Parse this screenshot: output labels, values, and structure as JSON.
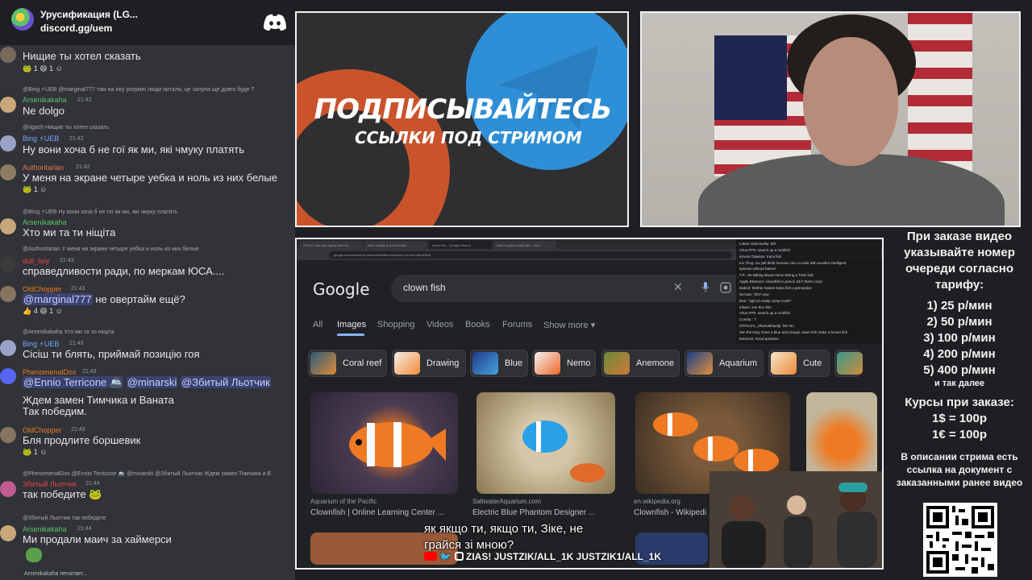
{
  "server": {
    "name": "Урусификация (LG...",
    "invite": "discord.gg/uem"
  },
  "chat": {
    "typing": "Arsenikakaha печатает...",
    "messages": [
      {
        "body": "Нищие ты хотел сказать",
        "reactions": "1 😄 1"
      },
      {
        "reply": "@Bing ⚡UEB @marginal777 там на кіку розумні люди питали, це залупа ще довго буде ?",
        "user": "Arsenikakaha",
        "user_color": "#5dc16c",
        "time": "21:42",
        "body": "Ne dolgo"
      },
      {
        "reply": "@rigach Нищие ты хотел сказать",
        "user": "Bing ⚡UEB",
        "user_color": "#7aa7ff",
        "time": "21:42",
        "body": "Ну вони хоча б не гої як ми, які чмуку платять"
      },
      {
        "user": "Authoritarian",
        "user_color": "#e0774f",
        "time": "21:42",
        "body": "У меня на экране четыре уебка и ноль из них белые",
        "reactions": "1"
      },
      {
        "reply": "@Bing ⚡UEB Ну вони хоча б не гої як ми, які чмуку платять",
        "user": "Arsenikakaha",
        "user_color": "#5dc16c",
        "body": "Хто ми та ти ніщіта"
      },
      {
        "reply": "@Authoritarian У меня на экране четыре уебка и ноль из них белые",
        "user": "dull_boy",
        "user_color": "#ed4245",
        "time": "21:43",
        "body": "справедливости ради, по меркам ЮСА...."
      },
      {
        "user": "OldChopper",
        "user_color": "#e67e22",
        "time": "21:43",
        "body_mention": "@marginal777",
        "body": " не овертайм ещё?",
        "reactions": "4 😄 1"
      },
      {
        "reply": "@Arsenikakaha Хто ми та ти ніщіта",
        "user": "Bing ⚡UEB",
        "user_color": "#7aa7ff",
        "time": "21:43",
        "body": "Сісіш ти блять, приймай позицію гоя"
      },
      {
        "user": "PhenomenalDox",
        "user_color": "#e67e22",
        "time": "21:43",
        "mentions": [
          "@Ennio Terricone 🚢",
          "@minarski",
          "@Збитый Льотчик"
        ],
        "body": "Ждем замен Тимчика и Ваната",
        "body2": "Так победим."
      },
      {
        "user": "OldChopper",
        "user_color": "#e67e22",
        "time": "21:43",
        "body": "Бля продлите боршевик",
        "reactions": "1"
      },
      {
        "reply": "@PhenomenalDox @Ennio Terricone 🚢 @minarski @Збитый Льотчик Ждем замен Тимчика и В",
        "user": "Збитый Льотчик",
        "user_color": "#ed4245",
        "time": "21:44",
        "body": "так победите"
      },
      {
        "reply": "@Збитый Льотчик так победите",
        "user": "Arsenikakaha",
        "user_color": "#5dc16c",
        "time": "21:44",
        "body": "Ми продали маич за хаймерси"
      }
    ]
  },
  "promo": {
    "title": "ПОДПИСЫВАЙТЕСЬ",
    "subtitle": "ССЫЛКИ ПОД СТРИМОМ"
  },
  "browser": {
    "tabs": [
      "STALC: live chat replay (flud.io)",
      "what exactly is a clown fish",
      "clown fish - Google Search",
      "what is green mask fish - Goo..."
    ],
    "url": "google.com/search?q=clown+fish&tbm=isch&sa=X&ved=2ahUKEwj",
    "query": "clown fish",
    "nav": [
      "All",
      "Images",
      "Shopping",
      "Videos",
      "Books",
      "Forums",
      "Show more ▾"
    ],
    "chips": [
      "Coral reef",
      "Drawing",
      "Blue",
      "Nemo",
      "Anemone",
      "Aquarium",
      "Cute"
    ],
    "results": [
      {
        "source": "Aquarium of the Pacific",
        "title": "Clownfish | Online Learning Center ..."
      },
      {
        "source": "SaltwaterAquarium.com",
        "title": "Electric Blue Phantom Designer ..."
      },
      {
        "source": "en.wikipedia.org",
        "title": "Clownfish - Wikipedi"
      }
    ],
    "subtitle": "як якщо ти, якщо ти, Зіке, не грайся зі мною?",
    "socials": "ZIAS!  JUSTZIK/ALL_1K   JUSTZIK1/ALL_1K",
    "overlay_lines": [
      "Lukas Hosinovsky: 0/0",
      "Virus FPS: search up a rockfish",
      "Kevzer Dawson: trans fish",
      "Ice Thug: So yall think humans can co exist with another intelligent",
      "species without hatred",
      "T.P.: He talking about Homo Being a Train hull",
      "Apple Blossom: clownfish in prison 24/7 that's crazy",
      "Dab13: Mother Nature trans fish u perceptive",
      "Mr.Gae: 7007 now",
      "Dee: \"ugh im ready comp crush\"",
      "Inkwei: zee thru fish",
      "Virus FPS: search up a rockfish",
      "Consta : ?",
      "OFFICIAL_Shamakhaedji: fish No",
      "Zen the king: Does a blue and orange clown fish make a brown fish",
      "teesin16: Good question"
    ]
  },
  "info": {
    "order_text": "При заказе видео указывайте номер очереди согласно тарифу:",
    "tariffs": [
      "1) 25 р/мин",
      "2) 50 р/мин",
      "3) 100 р/мин",
      "4) 200 р/мин",
      "5) 400 р/мин"
    ],
    "etc": "и так далее",
    "rates_title": "Курсы при заказе:",
    "rates": [
      "1$ = 100р",
      "1€ = 100р"
    ],
    "doc_text": "В описании стрима есть ссылка на документ с заказанными ранее видео"
  }
}
